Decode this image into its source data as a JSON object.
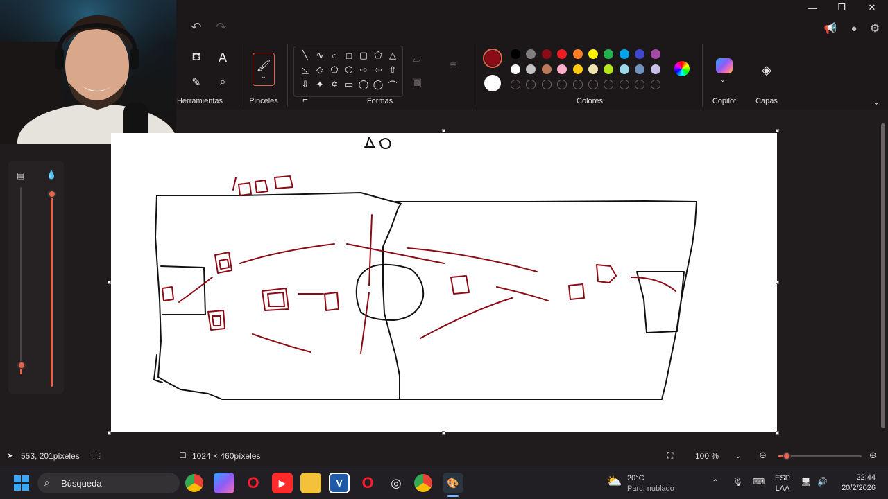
{
  "ribbon": {
    "groups": {
      "tools_label": "Herramientas",
      "brushes_label": "Pinceles",
      "shapes_label": "Formas",
      "colors_label": "Colores",
      "copilot_label": "Copilot",
      "layers_label": "Capas"
    },
    "shapes": [
      "╲",
      "∿",
      "○",
      "□",
      "▢",
      "⬠",
      "△",
      "◺",
      "◇",
      "⬠",
      "⬡",
      "⇨",
      "⇦",
      "⇧",
      "⇩",
      "✦",
      "✡",
      "▭",
      "◯",
      "◯",
      "⌒",
      "⌐"
    ],
    "colors": {
      "primary": "#8b0b16",
      "secondary": "#ffffff",
      "row1": [
        "#000000",
        "#7f7f7f",
        "#8b0b16",
        "#ed1c24",
        "#ff7f27",
        "#fff200",
        "#22b14c",
        "#00a2e8",
        "#3f48cc",
        "#a349a4"
      ],
      "row2": [
        "#ffffff",
        "#c3c3c3",
        "#b97a57",
        "#ffaec9",
        "#ffc90e",
        "#efe4b0",
        "#b5e61d",
        "#99d9ea",
        "#7092be",
        "#c8bfe7"
      ]
    }
  },
  "statusbar": {
    "cursor_pos": "553, 201píxeles",
    "canvas_size": "1024 × 460píxeles",
    "zoom": "100 %",
    "zoom_level": 0.1
  },
  "taskbar": {
    "search_label": "Búsqueda",
    "weather_temp": "20°C",
    "weather_desc": "Parc. nublado",
    "lang_top": "ESP",
    "lang_bottom": "LAA",
    "time": "22:44",
    "date": "20/2/2026"
  },
  "sliders": {
    "size_level": 0.05,
    "opacity_level": 1.0
  }
}
